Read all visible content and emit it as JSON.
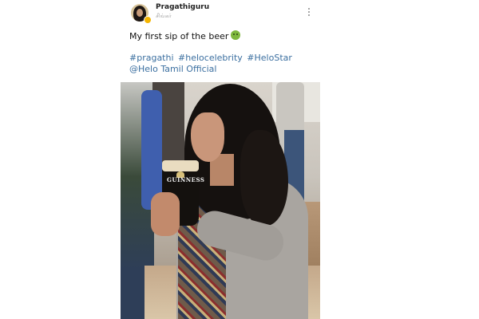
{
  "post": {
    "author": {
      "username": "Pragathiguru",
      "subtitle": "சிங்கர்"
    },
    "caption": "My first sip of the beer",
    "caption_emoji": "nauseated-face-emoji",
    "hashtags": [
      "#pragathi",
      "#helocelebrity",
      " #HeloStar"
    ],
    "mention": "@Helo Tamil Official",
    "image": {
      "glass_label": "GUINNESS"
    }
  },
  "colors": {
    "link": "#3b6fa0",
    "text": "#111111",
    "verified_badge": "#f4b400"
  },
  "icons": {
    "menu": "more-vertical-icon",
    "verified": "verified-badge-icon"
  }
}
